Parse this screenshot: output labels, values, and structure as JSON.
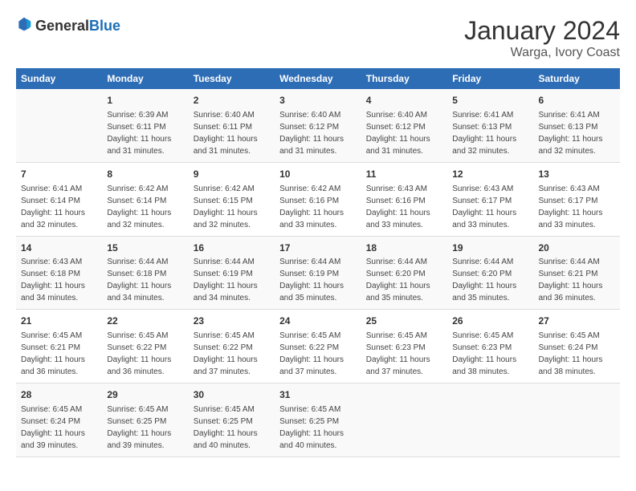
{
  "logo": {
    "general": "General",
    "blue": "Blue"
  },
  "title": "January 2024",
  "location": "Warga, Ivory Coast",
  "days_header": [
    "Sunday",
    "Monday",
    "Tuesday",
    "Wednesday",
    "Thursday",
    "Friday",
    "Saturday"
  ],
  "weeks": [
    [
      {
        "day": "",
        "sunrise": "",
        "sunset": "",
        "daylight": ""
      },
      {
        "day": "1",
        "sunrise": "Sunrise: 6:39 AM",
        "sunset": "Sunset: 6:11 PM",
        "daylight": "Daylight: 11 hours and 31 minutes."
      },
      {
        "day": "2",
        "sunrise": "Sunrise: 6:40 AM",
        "sunset": "Sunset: 6:11 PM",
        "daylight": "Daylight: 11 hours and 31 minutes."
      },
      {
        "day": "3",
        "sunrise": "Sunrise: 6:40 AM",
        "sunset": "Sunset: 6:12 PM",
        "daylight": "Daylight: 11 hours and 31 minutes."
      },
      {
        "day": "4",
        "sunrise": "Sunrise: 6:40 AM",
        "sunset": "Sunset: 6:12 PM",
        "daylight": "Daylight: 11 hours and 31 minutes."
      },
      {
        "day": "5",
        "sunrise": "Sunrise: 6:41 AM",
        "sunset": "Sunset: 6:13 PM",
        "daylight": "Daylight: 11 hours and 32 minutes."
      },
      {
        "day": "6",
        "sunrise": "Sunrise: 6:41 AM",
        "sunset": "Sunset: 6:13 PM",
        "daylight": "Daylight: 11 hours and 32 minutes."
      }
    ],
    [
      {
        "day": "7",
        "sunrise": "Sunrise: 6:41 AM",
        "sunset": "Sunset: 6:14 PM",
        "daylight": "Daylight: 11 hours and 32 minutes."
      },
      {
        "day": "8",
        "sunrise": "Sunrise: 6:42 AM",
        "sunset": "Sunset: 6:14 PM",
        "daylight": "Daylight: 11 hours and 32 minutes."
      },
      {
        "day": "9",
        "sunrise": "Sunrise: 6:42 AM",
        "sunset": "Sunset: 6:15 PM",
        "daylight": "Daylight: 11 hours and 32 minutes."
      },
      {
        "day": "10",
        "sunrise": "Sunrise: 6:42 AM",
        "sunset": "Sunset: 6:16 PM",
        "daylight": "Daylight: 11 hours and 33 minutes."
      },
      {
        "day": "11",
        "sunrise": "Sunrise: 6:43 AM",
        "sunset": "Sunset: 6:16 PM",
        "daylight": "Daylight: 11 hours and 33 minutes."
      },
      {
        "day": "12",
        "sunrise": "Sunrise: 6:43 AM",
        "sunset": "Sunset: 6:17 PM",
        "daylight": "Daylight: 11 hours and 33 minutes."
      },
      {
        "day": "13",
        "sunrise": "Sunrise: 6:43 AM",
        "sunset": "Sunset: 6:17 PM",
        "daylight": "Daylight: 11 hours and 33 minutes."
      }
    ],
    [
      {
        "day": "14",
        "sunrise": "Sunrise: 6:43 AM",
        "sunset": "Sunset: 6:18 PM",
        "daylight": "Daylight: 11 hours and 34 minutes."
      },
      {
        "day": "15",
        "sunrise": "Sunrise: 6:44 AM",
        "sunset": "Sunset: 6:18 PM",
        "daylight": "Daylight: 11 hours and 34 minutes."
      },
      {
        "day": "16",
        "sunrise": "Sunrise: 6:44 AM",
        "sunset": "Sunset: 6:19 PM",
        "daylight": "Daylight: 11 hours and 34 minutes."
      },
      {
        "day": "17",
        "sunrise": "Sunrise: 6:44 AM",
        "sunset": "Sunset: 6:19 PM",
        "daylight": "Daylight: 11 hours and 35 minutes."
      },
      {
        "day": "18",
        "sunrise": "Sunrise: 6:44 AM",
        "sunset": "Sunset: 6:20 PM",
        "daylight": "Daylight: 11 hours and 35 minutes."
      },
      {
        "day": "19",
        "sunrise": "Sunrise: 6:44 AM",
        "sunset": "Sunset: 6:20 PM",
        "daylight": "Daylight: 11 hours and 35 minutes."
      },
      {
        "day": "20",
        "sunrise": "Sunrise: 6:44 AM",
        "sunset": "Sunset: 6:21 PM",
        "daylight": "Daylight: 11 hours and 36 minutes."
      }
    ],
    [
      {
        "day": "21",
        "sunrise": "Sunrise: 6:45 AM",
        "sunset": "Sunset: 6:21 PM",
        "daylight": "Daylight: 11 hours and 36 minutes."
      },
      {
        "day": "22",
        "sunrise": "Sunrise: 6:45 AM",
        "sunset": "Sunset: 6:22 PM",
        "daylight": "Daylight: 11 hours and 36 minutes."
      },
      {
        "day": "23",
        "sunrise": "Sunrise: 6:45 AM",
        "sunset": "Sunset: 6:22 PM",
        "daylight": "Daylight: 11 hours and 37 minutes."
      },
      {
        "day": "24",
        "sunrise": "Sunrise: 6:45 AM",
        "sunset": "Sunset: 6:22 PM",
        "daylight": "Daylight: 11 hours and 37 minutes."
      },
      {
        "day": "25",
        "sunrise": "Sunrise: 6:45 AM",
        "sunset": "Sunset: 6:23 PM",
        "daylight": "Daylight: 11 hours and 37 minutes."
      },
      {
        "day": "26",
        "sunrise": "Sunrise: 6:45 AM",
        "sunset": "Sunset: 6:23 PM",
        "daylight": "Daylight: 11 hours and 38 minutes."
      },
      {
        "day": "27",
        "sunrise": "Sunrise: 6:45 AM",
        "sunset": "Sunset: 6:24 PM",
        "daylight": "Daylight: 11 hours and 38 minutes."
      }
    ],
    [
      {
        "day": "28",
        "sunrise": "Sunrise: 6:45 AM",
        "sunset": "Sunset: 6:24 PM",
        "daylight": "Daylight: 11 hours and 39 minutes."
      },
      {
        "day": "29",
        "sunrise": "Sunrise: 6:45 AM",
        "sunset": "Sunset: 6:25 PM",
        "daylight": "Daylight: 11 hours and 39 minutes."
      },
      {
        "day": "30",
        "sunrise": "Sunrise: 6:45 AM",
        "sunset": "Sunset: 6:25 PM",
        "daylight": "Daylight: 11 hours and 40 minutes."
      },
      {
        "day": "31",
        "sunrise": "Sunrise: 6:45 AM",
        "sunset": "Sunset: 6:25 PM",
        "daylight": "Daylight: 11 hours and 40 minutes."
      },
      {
        "day": "",
        "sunrise": "",
        "sunset": "",
        "daylight": ""
      },
      {
        "day": "",
        "sunrise": "",
        "sunset": "",
        "daylight": ""
      },
      {
        "day": "",
        "sunrise": "",
        "sunset": "",
        "daylight": ""
      }
    ]
  ]
}
